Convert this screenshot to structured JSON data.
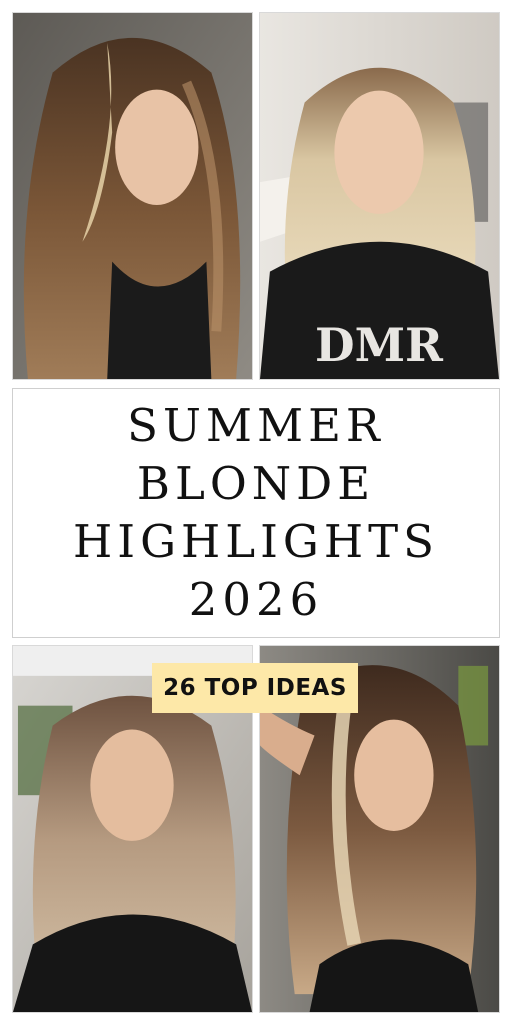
{
  "title": {
    "lines": [
      "SUMMER",
      "BLONDE",
      "HIGHLIGHTS",
      "2026"
    ]
  },
  "badge": "26 TOP IDEAS",
  "photos": [
    {
      "description_icon": "woman-portrait-image"
    },
    {
      "description_icon": "woman-portrait-image",
      "cape_logo": "DMR"
    },
    {
      "description_icon": "woman-portrait-image"
    },
    {
      "description_icon": "woman-portrait-image"
    }
  ],
  "colors": {
    "badge_bg": "#fde8a8",
    "text": "#111111",
    "hair_brown": "#6b4a32",
    "hair_blonde": "#d8c3a0"
  }
}
